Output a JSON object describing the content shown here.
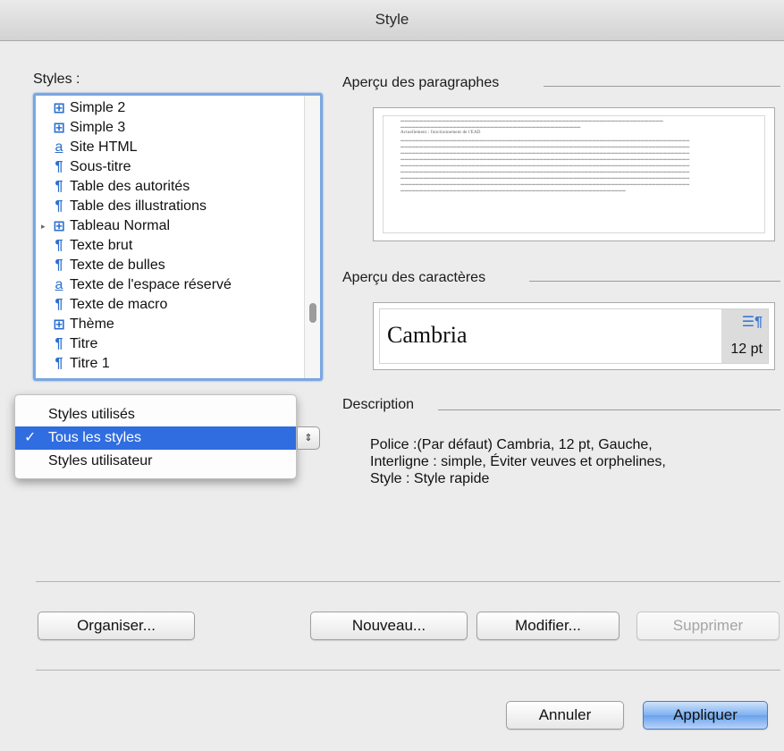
{
  "window": {
    "title": "Style"
  },
  "styles_panel": {
    "label": "Styles :",
    "items": [
      {
        "icon": "table-icon",
        "glyph": "⊞",
        "label": "Simple 2",
        "disclosure": ""
      },
      {
        "icon": "table-icon",
        "glyph": "⊞",
        "label": "Simple 3",
        "disclosure": ""
      },
      {
        "icon": "character-style-icon",
        "glyph": "a",
        "label": "Site HTML",
        "disclosure": ""
      },
      {
        "icon": "paragraph-icon",
        "glyph": "¶",
        "label": "Sous-titre",
        "disclosure": ""
      },
      {
        "icon": "paragraph-icon",
        "glyph": "¶",
        "label": "Table des autorités",
        "disclosure": ""
      },
      {
        "icon": "paragraph-icon",
        "glyph": "¶",
        "label": "Table des illustrations",
        "disclosure": ""
      },
      {
        "icon": "table-icon",
        "glyph": "⊞",
        "label": "Tableau Normal",
        "disclosure": "▸"
      },
      {
        "icon": "paragraph-icon",
        "glyph": "¶",
        "label": "Texte brut",
        "disclosure": ""
      },
      {
        "icon": "paragraph-icon",
        "glyph": "¶",
        "label": "Texte de bulles",
        "disclosure": ""
      },
      {
        "icon": "character-style-icon",
        "glyph": "a",
        "label": "Texte de l'espace réservé",
        "disclosure": ""
      },
      {
        "icon": "paragraph-icon",
        "glyph": "¶",
        "label": "Texte de macro",
        "disclosure": ""
      },
      {
        "icon": "table-icon",
        "glyph": "⊞",
        "label": "Thème",
        "disclosure": ""
      },
      {
        "icon": "paragraph-icon",
        "glyph": "¶",
        "label": "Titre",
        "disclosure": ""
      },
      {
        "icon": "paragraph-icon",
        "glyph": "¶",
        "label": "Titre 1",
        "disclosure": ""
      }
    ]
  },
  "list_filter_menu": {
    "options": [
      "Styles utilisés",
      "Tous les styles",
      "Styles utilisateur"
    ],
    "selected": "Tous les styles",
    "check": "✓",
    "stepper_glyph": "⇕"
  },
  "paragraph_preview": {
    "label": "Aperçu des paragraphes",
    "current_text": "Actuellement : fonctionnement de l'EAD"
  },
  "character_preview": {
    "label": "Aperçu des caractères",
    "font_name": "Cambria",
    "size": "12 pt",
    "align_glyph": "☰¶"
  },
  "description": {
    "label": "Description",
    "lines": [
      "Police :(Par défaut) Cambria, 12 pt, Gauche,",
      "Interligne :  simple, Éviter veuves et orphelines,",
      "Style : Style rapide"
    ]
  },
  "buttons": {
    "organize": "Organiser...",
    "new": "Nouveau...",
    "modify": "Modifier...",
    "delete": "Supprimer",
    "cancel": "Annuler",
    "apply": "Appliquer"
  },
  "colors": {
    "accent": "#2f6de0",
    "focus_ring": "#7aa7e0",
    "icon_blue": "#2a6fd1"
  }
}
